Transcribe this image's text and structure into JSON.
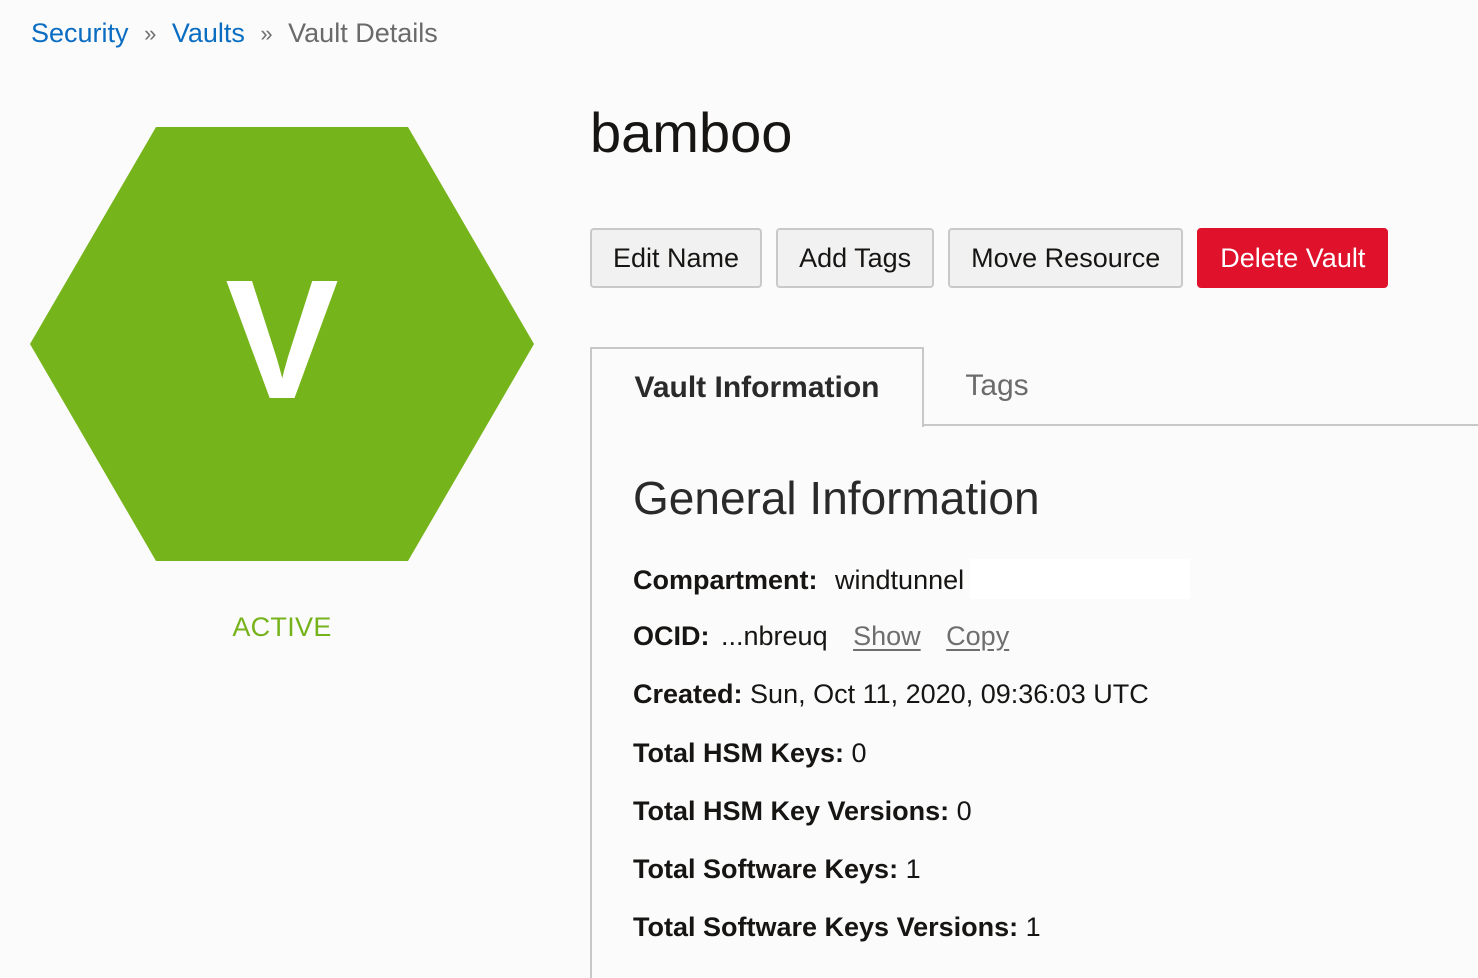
{
  "breadcrumb": {
    "items": [
      {
        "label": "Security"
      },
      {
        "label": "Vaults"
      }
    ],
    "separator": "»",
    "current": "Vault Details"
  },
  "resource": {
    "icon_letter": "V",
    "icon_color": "#76b41b",
    "status": "ACTIVE",
    "status_color": "#76b31b",
    "name": "bamboo"
  },
  "actions": {
    "edit_name": "Edit Name",
    "add_tags": "Add Tags",
    "move_resource": "Move Resource",
    "delete_vault": "Delete Vault",
    "danger_color": "#e0112b"
  },
  "tabs": [
    {
      "label": "Vault Information",
      "active": true
    },
    {
      "label": "Tags",
      "active": false
    }
  ],
  "general_information": {
    "title": "General Information",
    "compartment_label": "Compartment:",
    "compartment_value": "windtunnel",
    "ocid_label": "OCID:",
    "ocid_value": "...nbreuq",
    "ocid_show": "Show",
    "ocid_copy": "Copy",
    "created_label": "Created:",
    "created_value": "Sun, Oct 11, 2020, 09:36:03 UTC",
    "hsm_keys_label": "Total HSM Keys:",
    "hsm_keys_value": "0",
    "hsm_key_versions_label": "Total HSM Key Versions:",
    "hsm_key_versions_value": "0",
    "software_keys_label": "Total Software Keys:",
    "software_keys_value": "1",
    "software_keys_versions_label": "Total Software Keys Versions:",
    "software_keys_versions_value": "1"
  }
}
